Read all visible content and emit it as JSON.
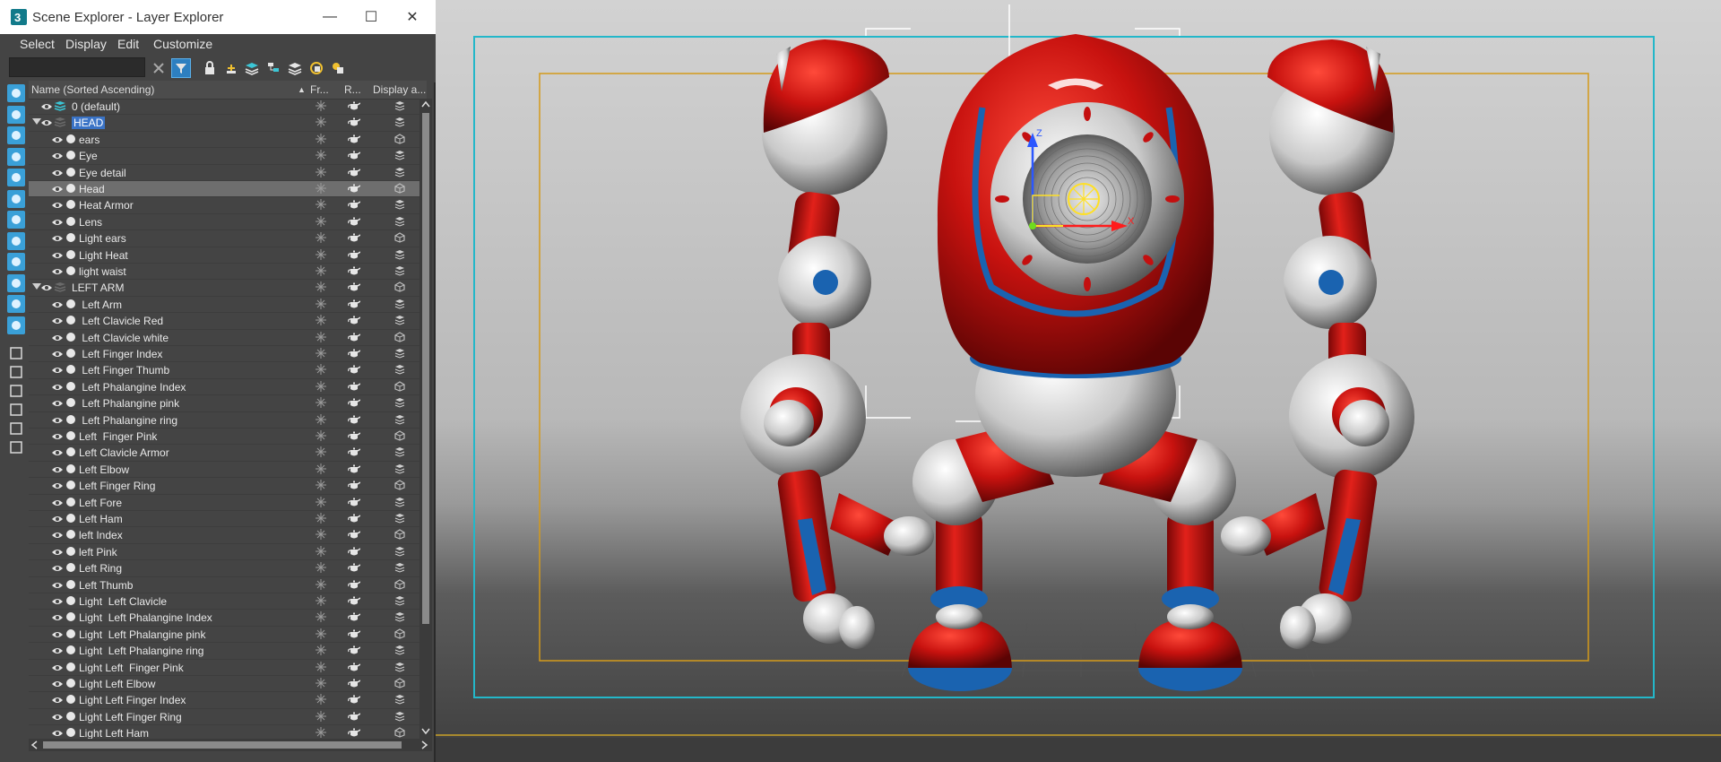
{
  "window": {
    "title": "Scene Explorer - Layer Explorer",
    "minimize": "—",
    "maximize": "☐",
    "close": "✕"
  },
  "menu": [
    "Select",
    "Display",
    "Edit",
    "Customize"
  ],
  "search": {
    "value": "",
    "placeholder": ""
  },
  "toolbar_icons": [
    "clear-search-icon",
    "filter-icon",
    "lock-icon",
    "new-layer-icon",
    "add-to-layer-icon",
    "layer-manager-icon",
    "hierarchy-icon",
    "layers-icon",
    "sync-icon"
  ],
  "columns": {
    "name": "Name (Sorted Ascending)",
    "sort_arrow": "▲",
    "frozen": "Fr...",
    "render": "R...",
    "display": "Display a..."
  },
  "rows": [
    {
      "name": "0 (default)",
      "level": 0,
      "type": "default-layer"
    },
    {
      "name": "HEAD",
      "level": 0,
      "type": "layer",
      "expanded": true,
      "selected": true
    },
    {
      "name": "ears",
      "level": 1
    },
    {
      "name": "Eye",
      "level": 1
    },
    {
      "name": "Eye detail",
      "level": 1
    },
    {
      "name": "Head",
      "level": 1,
      "highlighted": true
    },
    {
      "name": "Heat Armor",
      "level": 1
    },
    {
      "name": "Lens",
      "level": 1
    },
    {
      "name": "Light ears",
      "level": 1
    },
    {
      "name": "Light Heat",
      "level": 1
    },
    {
      "name": "light waist",
      "level": 1
    },
    {
      "name": "LEFT ARM",
      "level": 0,
      "type": "layer",
      "expanded": true
    },
    {
      "name": " Left Arm",
      "level": 1
    },
    {
      "name": " Left Clavicle Red",
      "level": 1
    },
    {
      "name": " Left Clavicle white",
      "level": 1
    },
    {
      "name": " Left Finger Index",
      "level": 1
    },
    {
      "name": " Left Finger Thumb",
      "level": 1
    },
    {
      "name": " Left Phalangine Index",
      "level": 1
    },
    {
      "name": " Left Phalangine pink",
      "level": 1
    },
    {
      "name": " Left Phalangine ring",
      "level": 1
    },
    {
      "name": "Left  Finger Pink",
      "level": 1
    },
    {
      "name": "Left Clavicle Armor",
      "level": 1
    },
    {
      "name": "Left Elbow",
      "level": 1
    },
    {
      "name": "Left Finger Ring",
      "level": 1
    },
    {
      "name": "Left Fore",
      "level": 1
    },
    {
      "name": "Left Ham",
      "level": 1
    },
    {
      "name": "left Index",
      "level": 1
    },
    {
      "name": "left Pink",
      "level": 1
    },
    {
      "name": "Left Ring",
      "level": 1
    },
    {
      "name": "Left Thumb",
      "level": 1
    },
    {
      "name": "Light  Left Clavicle",
      "level": 1
    },
    {
      "name": "Light  Left Phalangine Index",
      "level": 1
    },
    {
      "name": "Light  Left Phalangine pink",
      "level": 1
    },
    {
      "name": "Light  Left Phalangine ring",
      "level": 1
    },
    {
      "name": "Light Left  Finger Pink",
      "level": 1
    },
    {
      "name": "Light Left Elbow",
      "level": 1
    },
    {
      "name": "Light Left Finger Index",
      "level": 1
    },
    {
      "name": "Light Left Finger Ring",
      "level": 1
    },
    {
      "name": "Light Left Ham",
      "level": 1
    }
  ],
  "viewport": {
    "gizmo_axes": [
      "Z",
      "X"
    ],
    "colors": {
      "robot_red": "#c40f0f",
      "robot_blue": "#1a63b0",
      "safe_frame_outer": "#23b7c9",
      "safe_frame_inner": "#d49a1a"
    }
  }
}
